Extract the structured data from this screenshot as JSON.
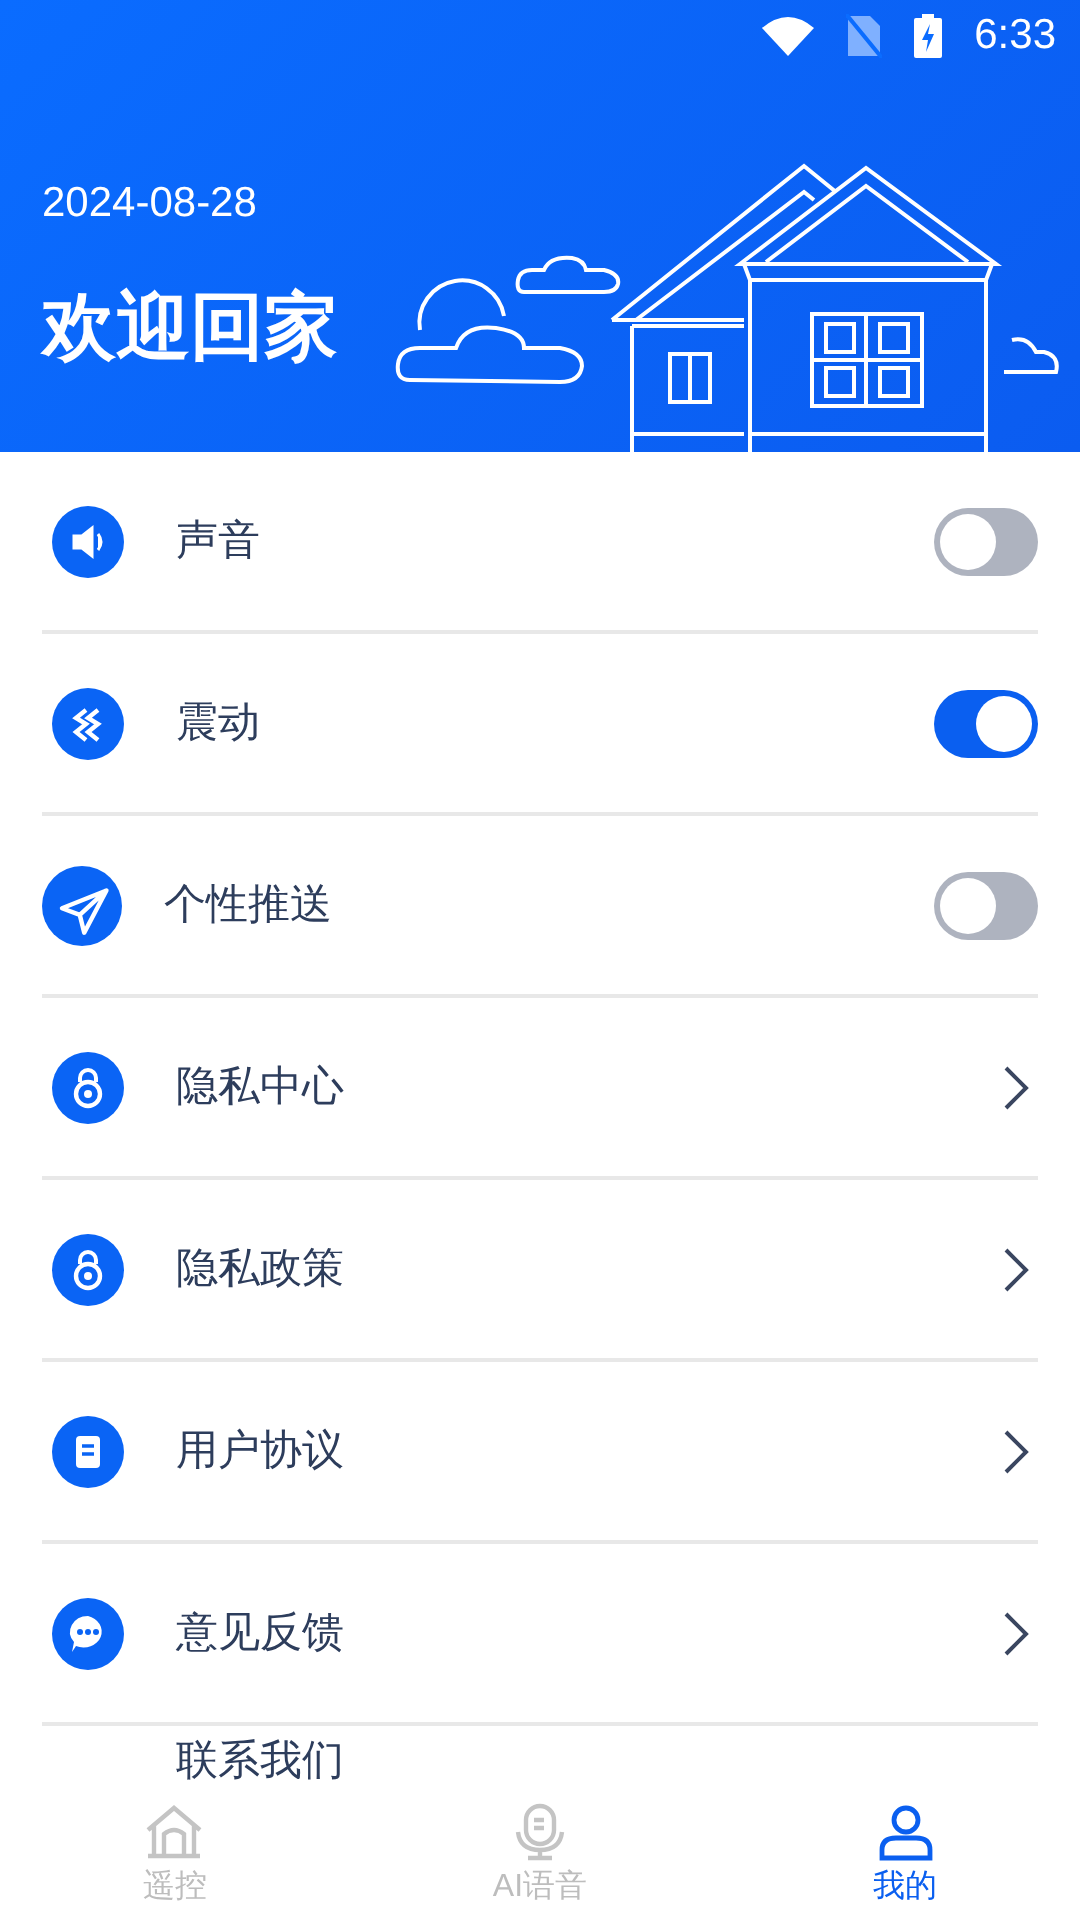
{
  "status_bar": {
    "time": "6:33"
  },
  "header": {
    "date": "2024-08-28",
    "title": "欢迎回家"
  },
  "settings": [
    {
      "kind": "toggle",
      "label": "声音",
      "on": false
    },
    {
      "kind": "toggle",
      "label": "震动",
      "on": true
    },
    {
      "kind": "toggle",
      "label": "个性推送",
      "on": false
    },
    {
      "kind": "link",
      "label": "隐私中心"
    },
    {
      "kind": "link",
      "label": "隐私政策"
    },
    {
      "kind": "link",
      "label": "用户协议"
    },
    {
      "kind": "link",
      "label": "意见反馈"
    },
    {
      "kind": "partial",
      "label": "联系我们"
    }
  ],
  "bottom_nav": [
    {
      "label": "遥控",
      "selected": false
    },
    {
      "label": "AI语音",
      "selected": false
    },
    {
      "label": "我的",
      "selected": true
    }
  ]
}
